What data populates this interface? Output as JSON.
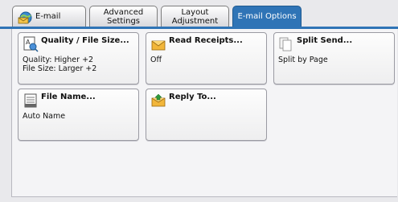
{
  "tabs": [
    {
      "label": "E-mail",
      "icon": "email-globe-icon",
      "active": false
    },
    {
      "label": "Advanced Settings",
      "active": false
    },
    {
      "label": "Layout Adjustment",
      "active": false
    },
    {
      "label": "E-mail Options",
      "active": true
    }
  ],
  "tab_labels": {
    "email": "E-mail",
    "advanced_line1": "Advanced",
    "advanced_line2": "Settings",
    "layout_line1": "Layout",
    "layout_line2": "Adjustment",
    "options": "E-mail Options"
  },
  "buttons": {
    "quality": {
      "title": "Quality / File Size...",
      "icon": "quality-file-size-icon",
      "line1": "Quality: Higher +2",
      "line2": "File Size: Larger +2"
    },
    "read_receipts": {
      "title": "Read Receipts...",
      "icon": "envelope-icon",
      "value": "Off"
    },
    "split_send": {
      "title": "Split Send...",
      "icon": "split-pages-icon",
      "value": "Split by Page"
    },
    "file_name": {
      "title": "File Name...",
      "icon": "document-icon",
      "value": "Auto Name"
    },
    "reply_to": {
      "title": "Reply To...",
      "icon": "reply-envelope-icon"
    }
  },
  "colors": {
    "accent": "#2f74b6",
    "background": "#e9e9ec"
  }
}
